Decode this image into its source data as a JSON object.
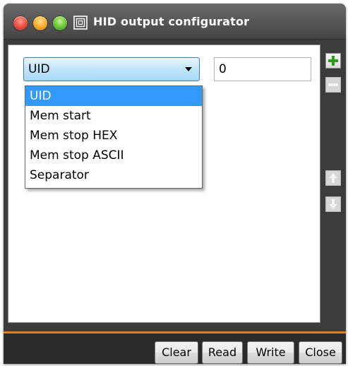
{
  "window": {
    "title": "HID output configurator",
    "controls": [
      "close-button",
      "minimize-button",
      "maximize-button"
    ]
  },
  "field_type": {
    "selected": "UID",
    "options": [
      "UID",
      "Mem start",
      "Mem stop HEX",
      "Mem stop ASCII",
      "Separator"
    ],
    "highlighted_index": 0
  },
  "value_input": {
    "value": "0"
  },
  "side_buttons": {
    "add": "plus-icon",
    "remove": "minus-icon",
    "move_up": "arrow-up-icon",
    "move_down": "arrow-down-icon"
  },
  "footer": {
    "clear_label": "Clear",
    "read_label": "Read",
    "write_label": "Write",
    "close_label": "Close"
  },
  "colors": {
    "selection": "#3399ff",
    "accent_line": "#e87f1e",
    "add_green": "#2e9d1e"
  }
}
